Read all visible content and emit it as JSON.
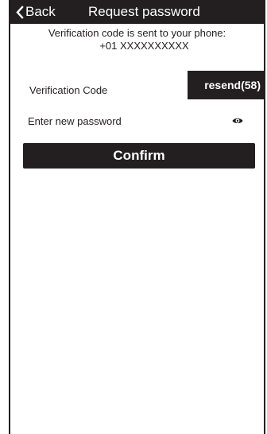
{
  "header": {
    "back_label": "Back",
    "back_icon": "chevron-left-icon",
    "title": "Request password"
  },
  "notice": {
    "line1": "Verification code is sent to your phone:",
    "line2": "+01 XXXXXXXXXX"
  },
  "verification": {
    "label": "Verification Code",
    "value": "",
    "resend_label": "resend(58)"
  },
  "new_password": {
    "placeholder": "Enter new password",
    "value": "",
    "toggle_icon": "eye-icon"
  },
  "confirm_label": "Confirm",
  "colors": {
    "primary": "#231f20",
    "text_on_primary": "#ffffff",
    "background": "#ffffff"
  }
}
